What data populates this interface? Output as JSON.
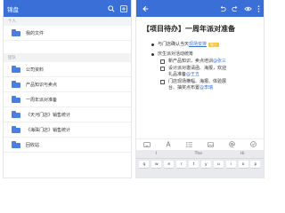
{
  "colors": {
    "accent": "#3a6fd8",
    "folder": "#4a7fe0",
    "tag": "#f5c542"
  },
  "left": {
    "app_title": "锦盘",
    "sections": [
      {
        "header": "个人",
        "items": [
          "我的文件"
        ]
      },
      {
        "header": "团队",
        "items": [
          "公司资料",
          "产品知识与卖点",
          "一周年派对准备",
          "《天河门店》销售统计",
          "《海珠门店》销售统计",
          "回收站"
        ]
      }
    ]
  },
  "right": {
    "title": "【项目待办】一周年派对准备",
    "lines": [
      {
        "kind": "bullet",
        "prefix": "与门店确认当天",
        "link": "现场安排",
        "tag": "张三"
      },
      {
        "kind": "bullet",
        "prefix": "庆生派对活动统筹"
      },
      {
        "kind": "check",
        "prefix": "新产品知识，卖点培训",
        "mention": "@张三"
      },
      {
        "kind": "check",
        "prefix": "设计派对邀请函、海报，欢迎"
      },
      {
        "kind": "cont",
        "prefix": "礼品准备",
        "mention": "@王五"
      },
      {
        "kind": "check",
        "prefix": "门店现场横幅、海报、体验展"
      },
      {
        "kind": "cont",
        "prefix": "台、抽奖点布置",
        "mention": "@李瑞"
      }
    ],
    "keyboard": {
      "suggestions": [
        "I",
        "The",
        "Hi"
      ],
      "row1": [
        "q",
        "w",
        "e",
        "r",
        "t",
        "y",
        "u",
        "i",
        "o",
        "p"
      ]
    }
  }
}
